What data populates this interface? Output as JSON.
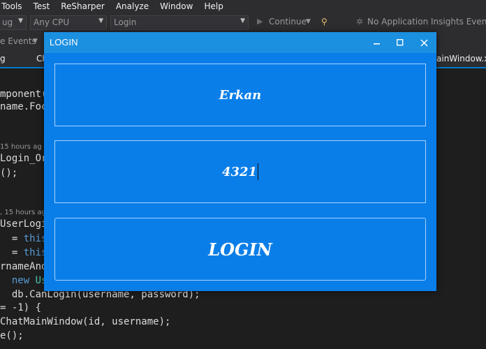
{
  "ide": {
    "menu": [
      "Tools",
      "Test",
      "ReSharper",
      "Analyze",
      "Window",
      "Help"
    ],
    "toolbar": {
      "config_combo": "ug",
      "platform_combo": "Any CPU",
      "startup_combo": "Login",
      "continue_label": "Continue",
      "insights_label": "No Application Insights Events"
    },
    "toolbar2": {
      "events_label": "e Events"
    },
    "tabs": [
      "g",
      "Ch",
      "ainWindow.x"
    ],
    "codelens": [
      "15 hours ag",
      ", 15 hours ag"
    ],
    "code": {
      "l1": "mponent(",
      "l2": "name.Foc",
      "l3": "Login_Or",
      "l4": "();",
      "l5": "UserLogi",
      "l6a": "  = ",
      "l6b": "this.",
      "l7a": "  = ",
      "l7b": "this.",
      "l8": "rnameAnd",
      "l9a": "  ",
      "l9b": "new ",
      "l9c": "Use",
      "l10": "  db.CanLogin(username, password);",
      "l11": "= -1) {",
      "l12": "ChatMainWindow(id, username);",
      "l13": "e();"
    }
  },
  "login_window": {
    "title": "LOGIN",
    "username_value": "Erkan",
    "password_value": "4321",
    "login_label": "LOGIN"
  }
}
